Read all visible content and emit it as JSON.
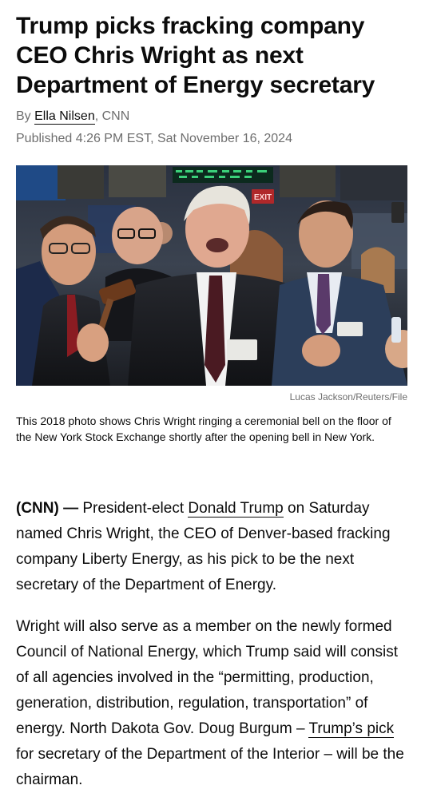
{
  "article": {
    "headline": "Trump picks fracking company CEO Chris Wright as next Department of Energy secretary",
    "byline_prefix": "By ",
    "author": "Ella Nilsen",
    "byline_suffix": ", CNN",
    "published": "Published 4:26 PM EST, Sat November 16, 2024"
  },
  "photo": {
    "exit_sign": "EXIT",
    "credit": "Lucas Jackson/Reuters/File",
    "caption": "This 2018 photo shows Chris Wright ringing a ceremonial bell on the floor of the New York Stock Exchange shortly after the opening bell in New York."
  },
  "body": {
    "p1_dateline": "(CNN) —",
    "p1_before_link": " President-elect ",
    "p1_link": "Donald Trump",
    "p1_after_link": " on Saturday named Chris Wright, the CEO of Denver-based fracking company Liberty Energy, as his pick to be the next secretary of the Department of Energy.",
    "p2_before_link": "Wright will also serve as a member on the newly formed Council of National Energy, which Trump said will consist of all agencies involved in the “permitting, production, generation, distribution, regulation, transportation” of energy. North Dakota Gov. Doug Burgum – ",
    "p2_link": "Trump’s pick",
    "p2_after_link": " for secretary of the Department of the Interior – will be the chairman."
  }
}
